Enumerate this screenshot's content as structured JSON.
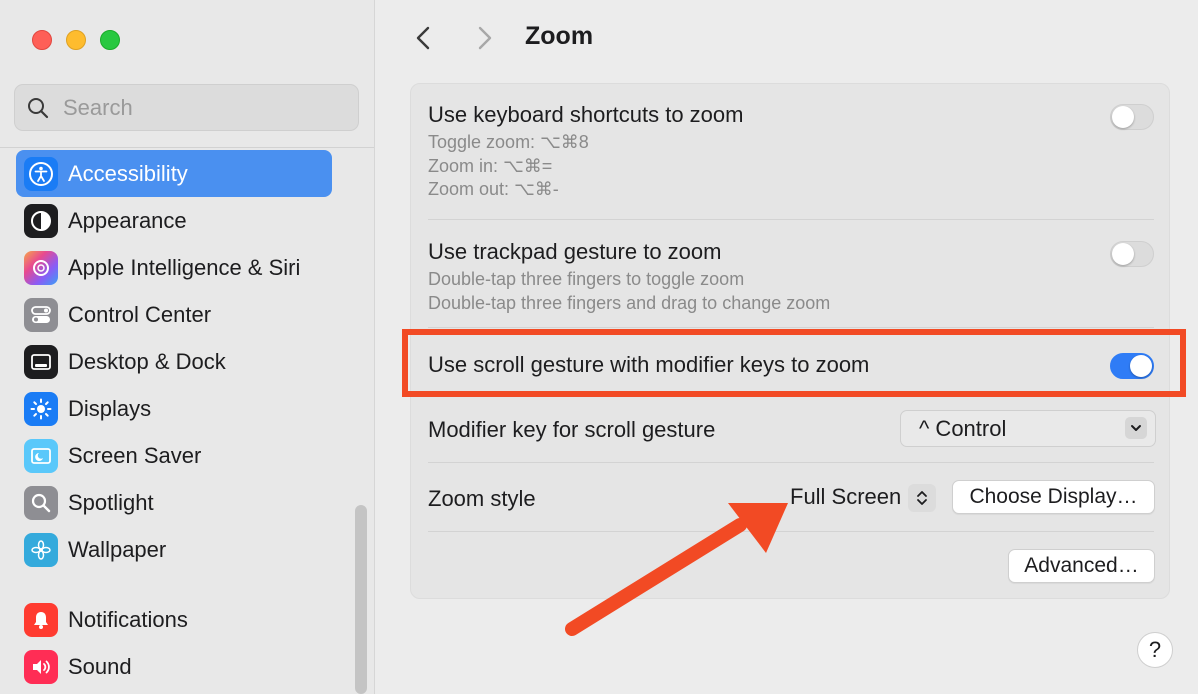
{
  "sidebar": {
    "search_placeholder": "Search",
    "items": [
      {
        "label": "Accessibility",
        "icon": "accessibility-icon",
        "selected": true
      },
      {
        "label": "Appearance",
        "icon": "appearance-icon"
      },
      {
        "label": "Apple Intelligence & Siri",
        "icon": "siri-icon"
      },
      {
        "label": "Control Center",
        "icon": "control-center-icon"
      },
      {
        "label": "Desktop & Dock",
        "icon": "desktop-dock-icon"
      },
      {
        "label": "Displays",
        "icon": "displays-icon"
      },
      {
        "label": "Screen Saver",
        "icon": "screen-saver-icon"
      },
      {
        "label": "Spotlight",
        "icon": "spotlight-icon"
      },
      {
        "label": "Wallpaper",
        "icon": "wallpaper-icon"
      },
      {
        "label": "Notifications",
        "icon": "notifications-icon"
      },
      {
        "label": "Sound",
        "icon": "sound-icon"
      }
    ]
  },
  "header": {
    "title": "Zoom"
  },
  "settings": {
    "keyboard": {
      "title": "Use keyboard shortcuts to zoom",
      "lines": [
        "Toggle zoom: ⌥⌘8",
        "Zoom in: ⌥⌘=",
        "Zoom out: ⌥⌘-"
      ],
      "enabled": false
    },
    "trackpad": {
      "title": "Use trackpad gesture to zoom",
      "lines": [
        "Double-tap three fingers to toggle zoom",
        "Double-tap three fingers and drag to change zoom"
      ],
      "enabled": false
    },
    "scroll": {
      "title": "Use scroll gesture with modifier keys to zoom",
      "enabled": true
    },
    "modifier": {
      "title": "Modifier key for scroll gesture",
      "value": "^ Control"
    },
    "zoom_style": {
      "title": "Zoom style",
      "value": "Full Screen",
      "choose_display_label": "Choose Display…"
    },
    "advanced_label": "Advanced…"
  },
  "help_label": "?",
  "colors": {
    "accent": "#2f7cf6",
    "selection": "#4a90f0",
    "annotation": "#f24a24"
  }
}
